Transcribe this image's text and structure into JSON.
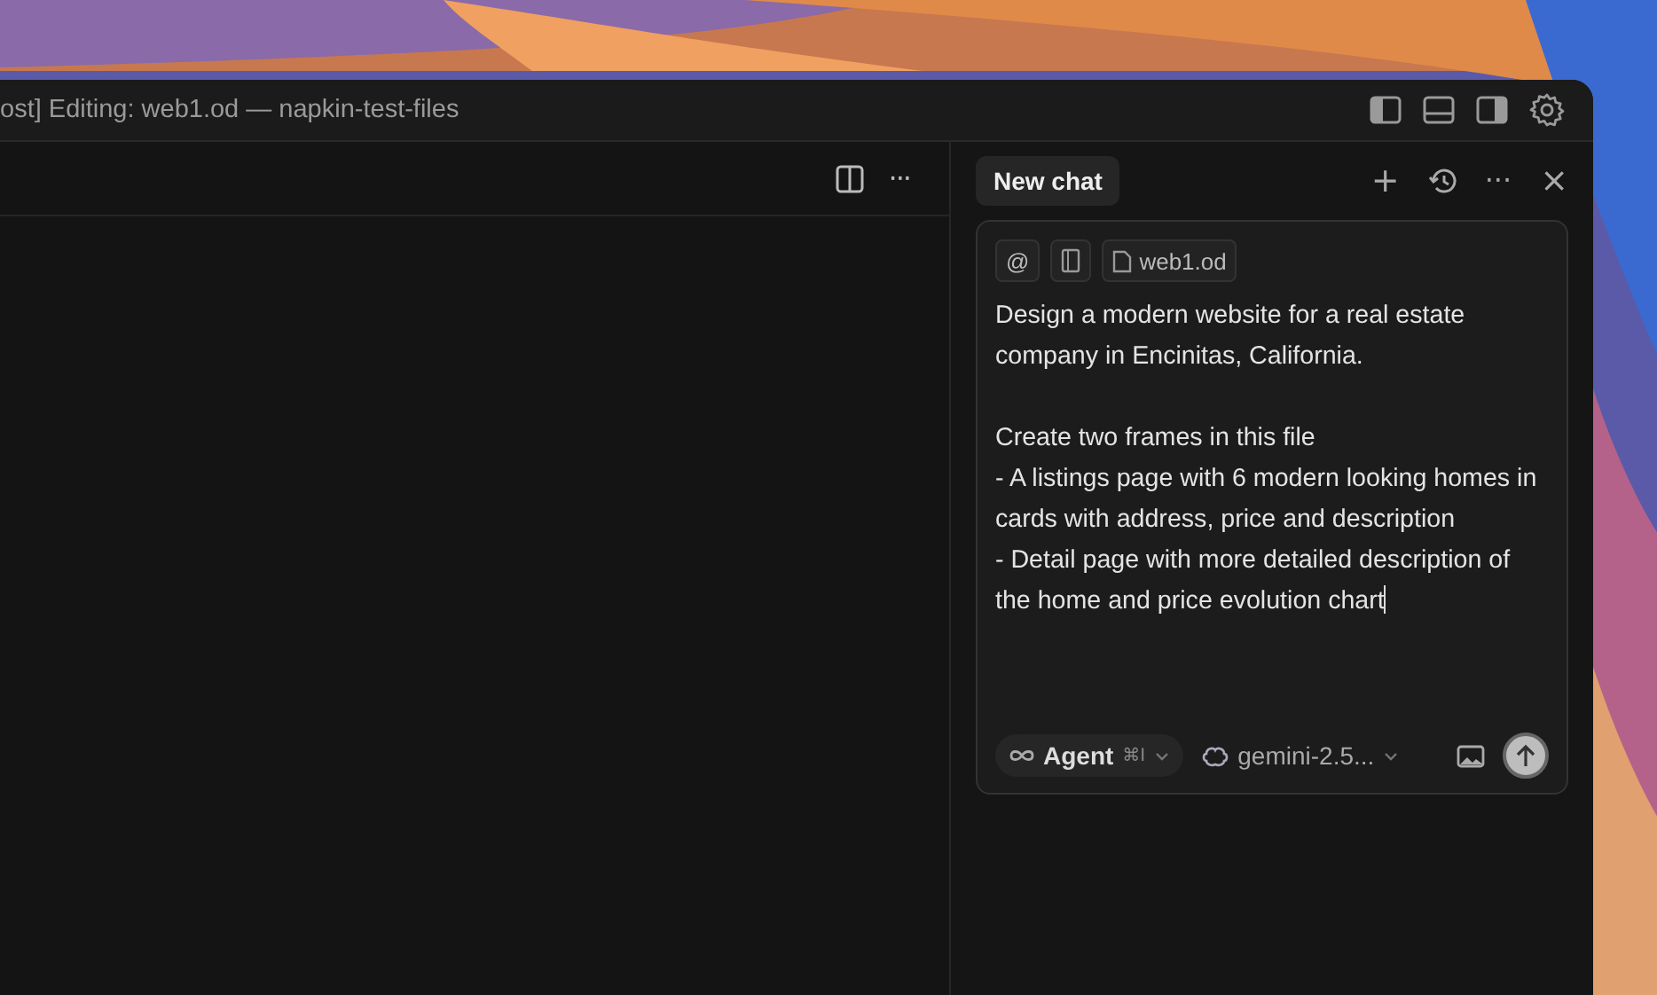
{
  "window": {
    "title": "ost] Editing: web1.od — napkin-test-files"
  },
  "editor": {
    "more_label": "···"
  },
  "chat": {
    "tab": {
      "label": "New chat",
      "selected": true
    },
    "actions": {
      "add": "+",
      "more": "···",
      "close": "×"
    },
    "context_chips": [
      {
        "kind": "mention",
        "label": "@"
      },
      {
        "kind": "file",
        "label": "web1.od"
      }
    ],
    "prompt": "Design a modern website for a real estate company in Encinitas, California.\n\nCreate two frames in this file\n- A listings page with 6 modern looking homes in cards with address, price and description\n- Detail page with more detailed description of the home and price evolution chart",
    "mode": {
      "label": "Agent",
      "shortcut": "⌘I"
    },
    "model": {
      "label": "gemini-2.5..."
    }
  }
}
